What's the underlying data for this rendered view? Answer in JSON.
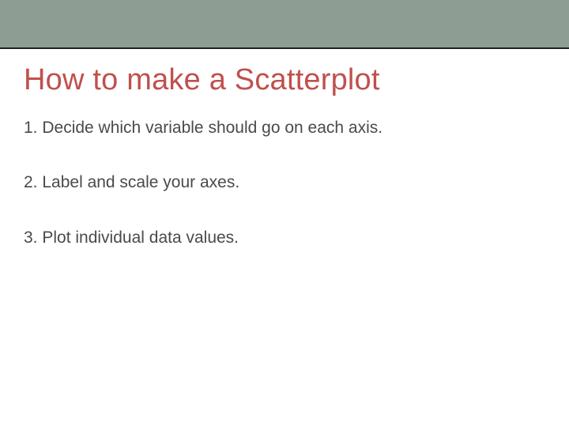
{
  "title": "How to make a Scatterplot",
  "steps": [
    "1.  Decide which variable should go on each axis.",
    "2.  Label and scale your axes.",
    "3.  Plot individual data values."
  ]
}
